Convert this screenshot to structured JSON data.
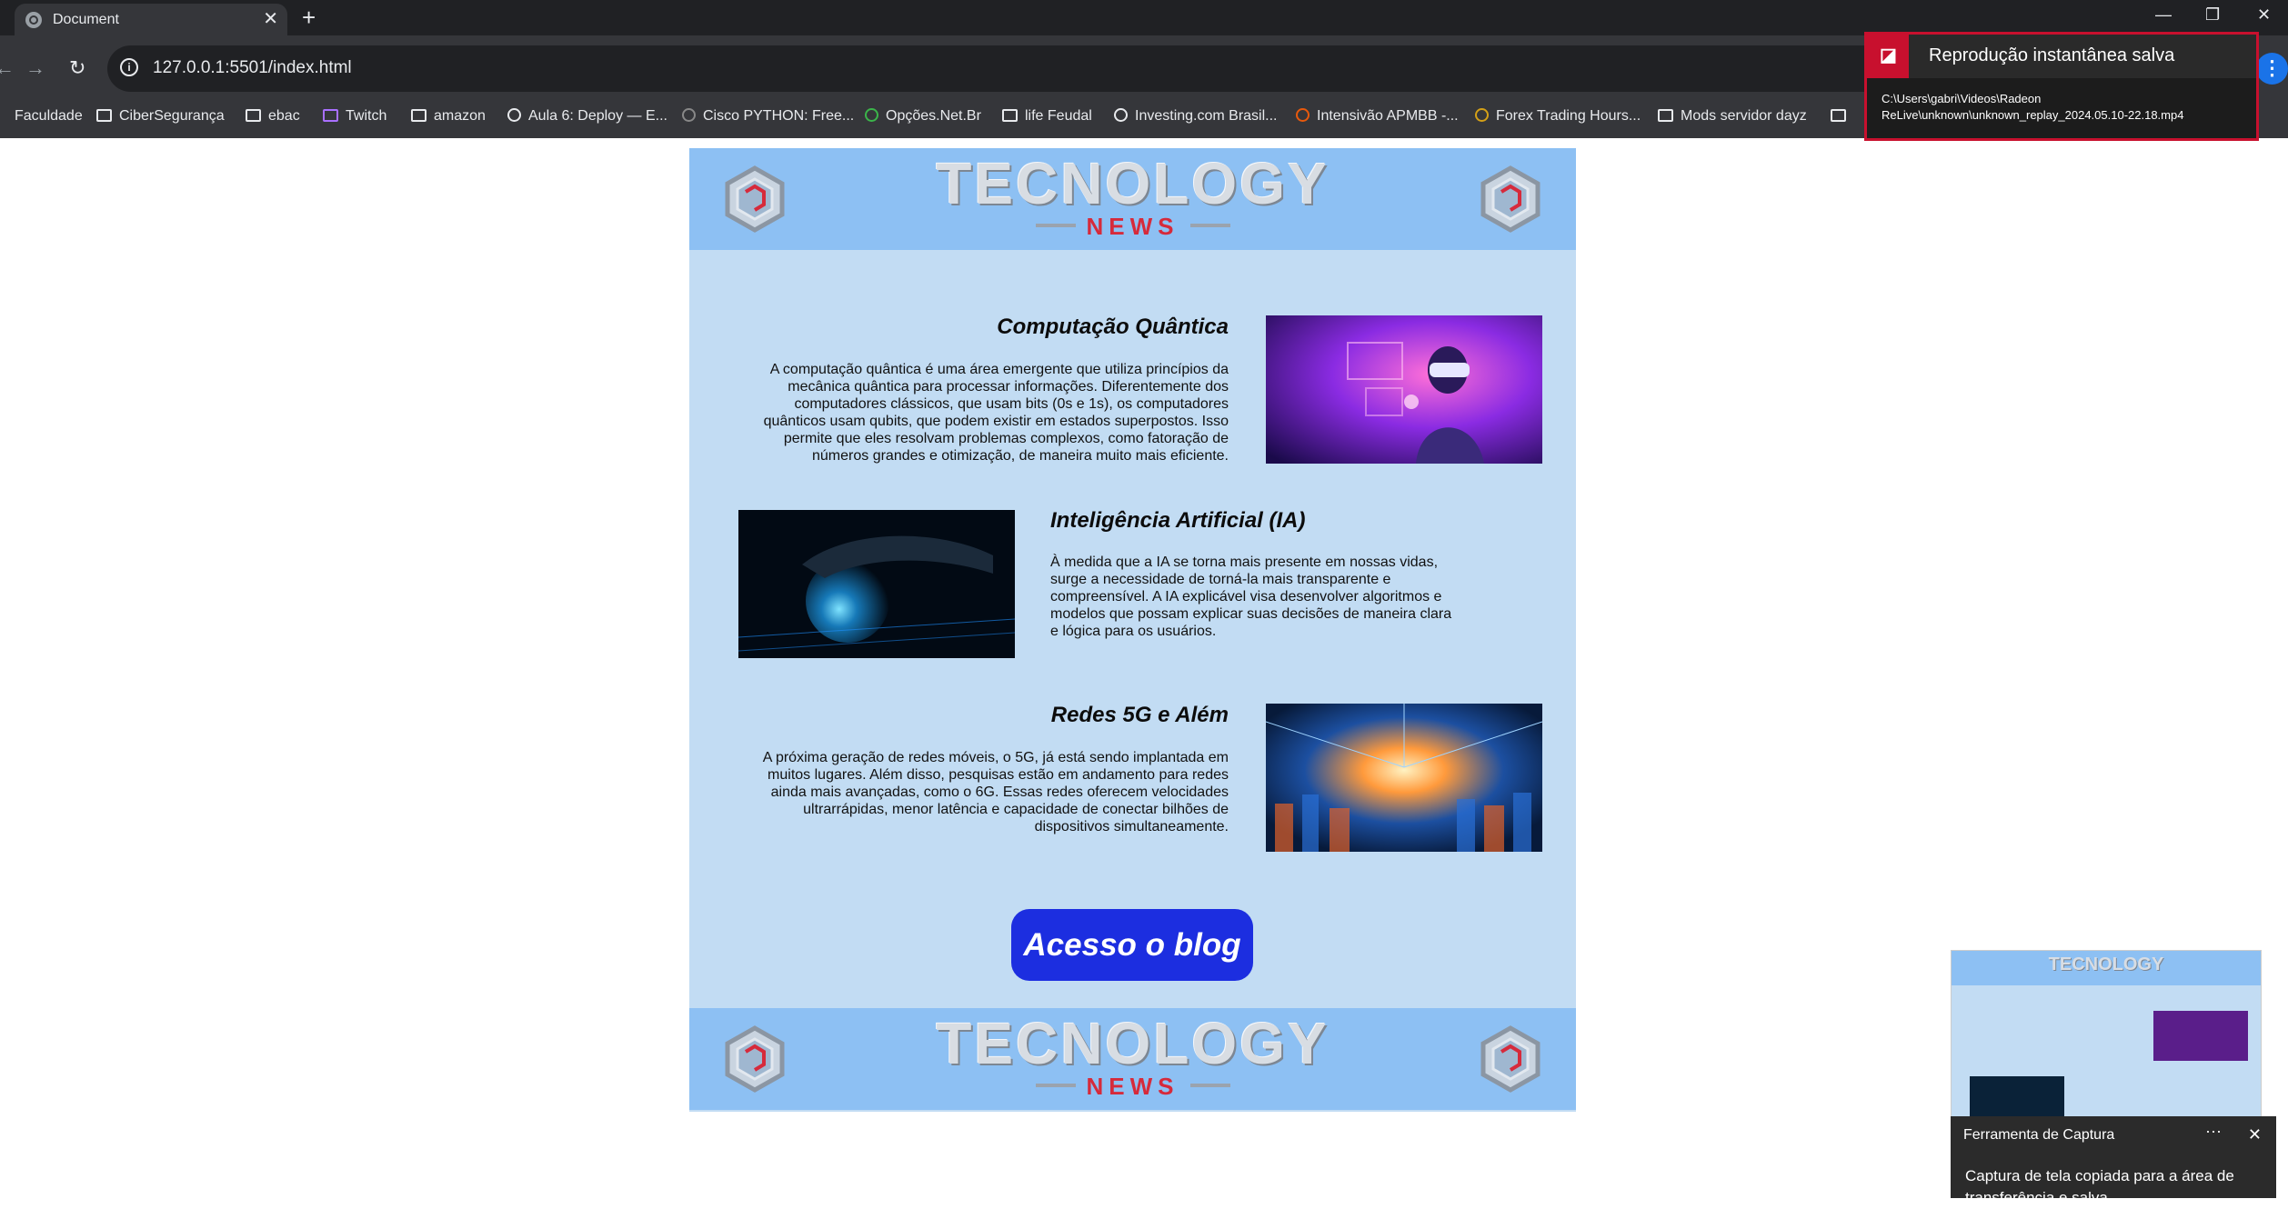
{
  "browser": {
    "tab_title": "Document",
    "url": "127.0.0.1:5501/index.html",
    "bookmarks": [
      {
        "label": "Faculdade",
        "icon": "folder-icon"
      },
      {
        "label": "CiberSegurança",
        "icon": "folder-icon"
      },
      {
        "label": "ebac",
        "icon": "folder-icon"
      },
      {
        "label": "Twitch",
        "icon": "twitch-icon"
      },
      {
        "label": "amazon",
        "icon": "folder-icon"
      },
      {
        "label": "Aula 6: Deploy — E...",
        "icon": "site-icon"
      },
      {
        "label": "Cisco PYTHON: Free...",
        "icon": "site-icon"
      },
      {
        "label": "Opções.Net.Br",
        "icon": "site-icon"
      },
      {
        "label": "life Feudal",
        "icon": "folder-icon"
      },
      {
        "label": "Investing.com Brasil...",
        "icon": "investing-icon"
      },
      {
        "label": "Intensivão APMBB -...",
        "icon": "fire-icon"
      },
      {
        "label": "Forex Trading Hours...",
        "icon": "site-icon"
      },
      {
        "label": "Mods servidor dayz",
        "icon": "folder-icon"
      }
    ]
  },
  "site": {
    "brand_main": "TECNOLOGY",
    "brand_sub": "NEWS",
    "articles": [
      {
        "title": "Computação Quântica",
        "text": "A computação quântica é uma área emergente que utiliza princípios da mecânica quântica para processar informações. Diferentemente dos computadores clássicos, que usam bits (0s e 1s), os computadores quânticos usam qubits, que podem existir em estados superpostos. Isso permite que eles resolvam problemas complexos, como fatoração de números grandes e otimização, de maneira muito mais eficiente."
      },
      {
        "title": "Inteligência Artificial (IA)",
        "text": "À medida que a IA se torna mais presente em nossas vidas, surge a necessidade de torná-la mais transparente e compreensível. A IA explicável visa desenvolver algoritmos e modelos que possam explicar suas decisões de maneira clara e lógica para os usuários."
      },
      {
        "title": "Redes 5G e Além",
        "text": "A próxima geração de redes móveis, o 5G, já está sendo implantada em muitos lugares. Além disso, pesquisas estão em andamento para redes ainda mais avançadas, como o 6G. Essas redes oferecem velocidades ultrarrápidas, menor latência e capacidade de conectar bilhões de dispositivos simultaneamente."
      }
    ],
    "cta_label": "Acesso o blog"
  },
  "notifications": {
    "radeon_title": "Reprodução instantânea salva",
    "radeon_path": "C:\\Users\\gabri\\Videos\\Radeon ReLive\\unknown\\unknown_replay_2024.05.10-22.18.mp4",
    "snip_app": "Ferramenta de Captura",
    "snip_body": "Captura de tela copiada para a área de transferência e salva"
  },
  "colors": {
    "page_bg": "#c2dcf3",
    "banner_bg": "#8dc0f3",
    "cta_bg": "#1c2ee0",
    "radeon_red": "#c8102e"
  }
}
